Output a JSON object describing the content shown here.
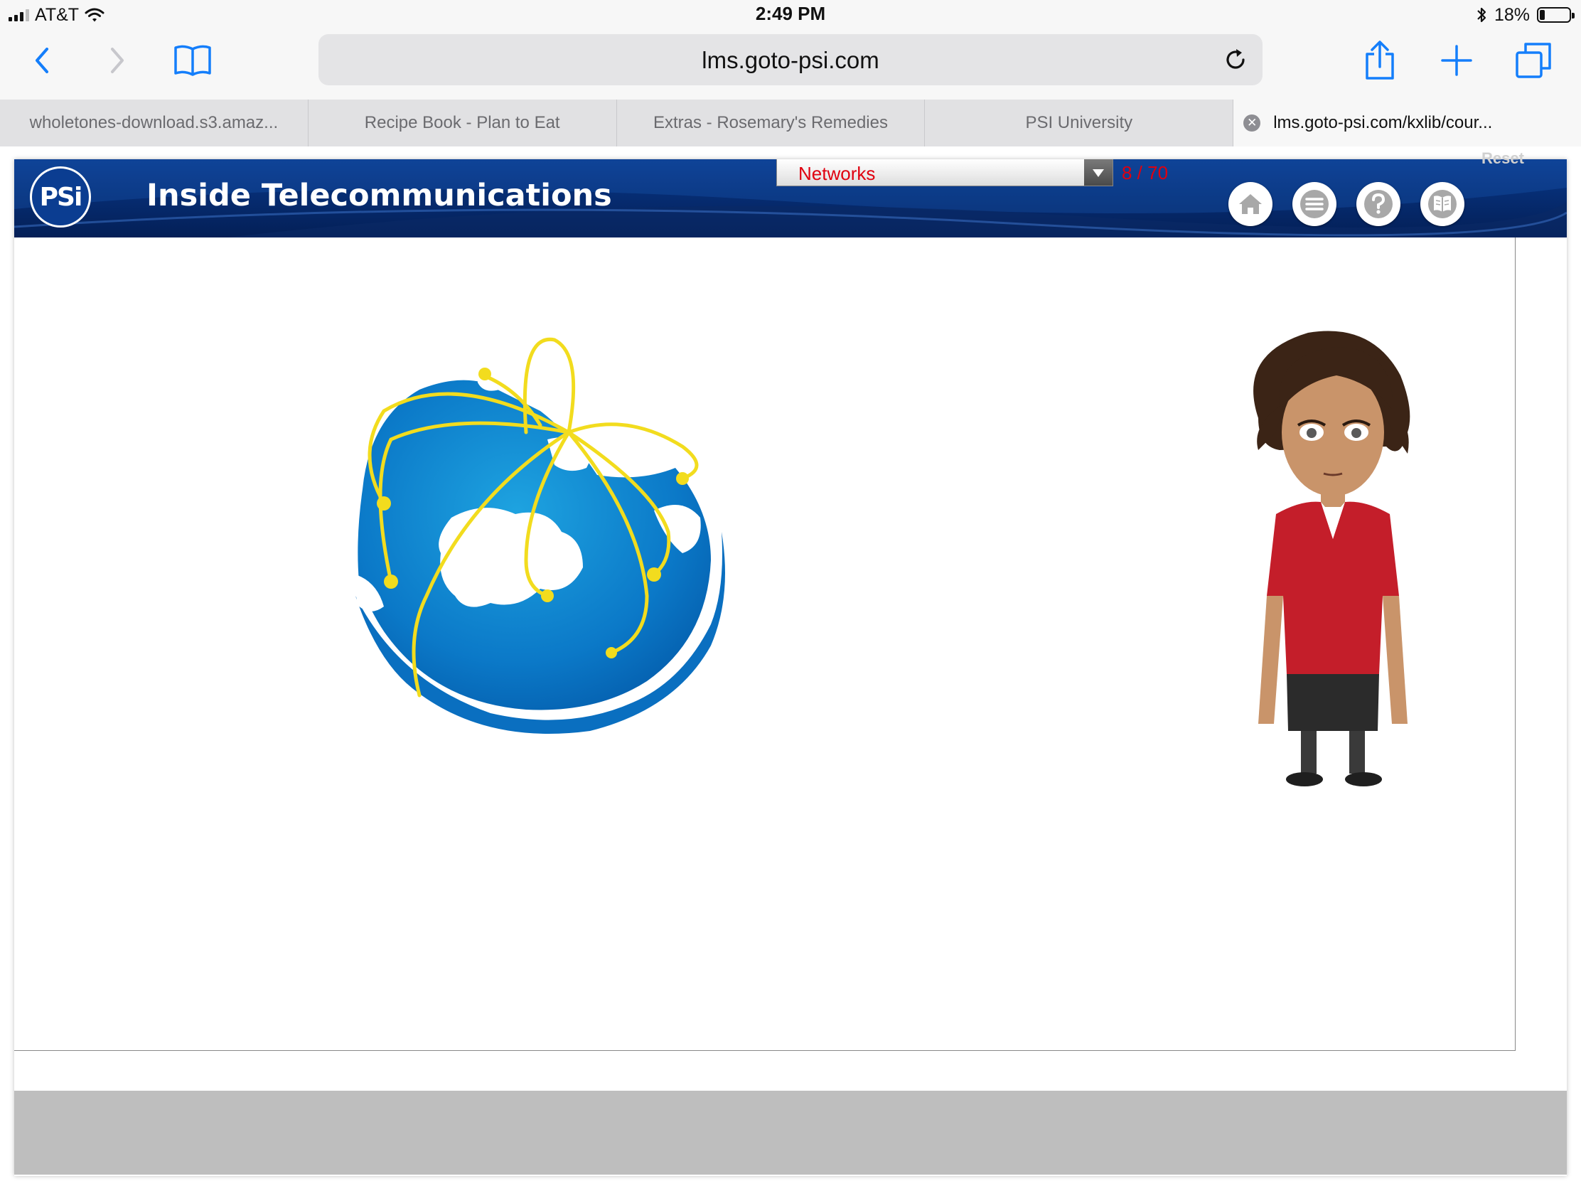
{
  "status_bar": {
    "carrier": "AT&T",
    "time": "2:49 PM",
    "battery": "18%",
    "battery_level": 0.18
  },
  "browser": {
    "url": "lms.goto-psi.com",
    "icons": [
      "back-icon",
      "forward-icon",
      "bookmarks-icon",
      "reload-icon",
      "share-icon",
      "new-tab-icon",
      "tabs-icon"
    ],
    "tabs": [
      {
        "label": "wholetones-download.s3.amaz..."
      },
      {
        "label": "Recipe Book - Plan to Eat"
      },
      {
        "label": "Extras - Rosemary's Remedies"
      },
      {
        "label": "PSI University"
      },
      {
        "label": "lms.goto-psi.com/kxlib/cour..."
      }
    ]
  },
  "course": {
    "logo": "PSi",
    "title": "Inside Telecommunications",
    "chapter": "Networks",
    "page_count": "8 / 70",
    "reset": "Reset",
    "nav_icons": [
      "home-icon",
      "menu-icon",
      "help-icon",
      "glossary-book-icon"
    ],
    "colors": {
      "header": "#062d73",
      "accent_red": "#e0000f",
      "globe_blue": "#0b79c8",
      "network_yellow": "#f2dc1e"
    }
  }
}
